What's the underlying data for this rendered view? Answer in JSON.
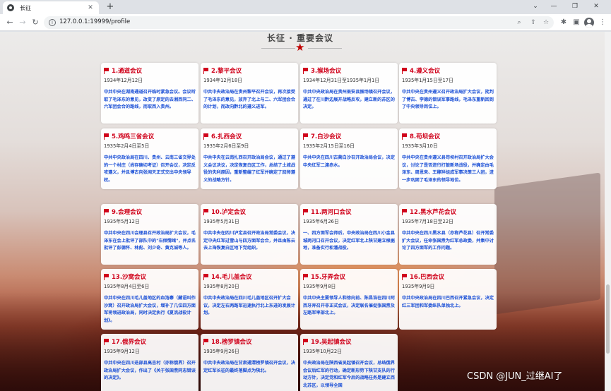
{
  "browser": {
    "tab_title": "长征",
    "url": "127.0.0.1:19999/profile"
  },
  "page": {
    "title": "长征 · 重要会议"
  },
  "meetings": [
    {
      "title": "1.通道会议",
      "date": "1934年12月12日",
      "desc": "中共中央在湖南通道召开临时紧急会议。会议听取了毛泽东的意见，改变了原定的去湘西同二、六军团会合的路线，而取西入贵州。"
    },
    {
      "title": "2.黎平会议",
      "date": "1934年12月18日",
      "desc": "中共中央政治局在贵州黎平召开会议，再次接受了毛泽东的意见，放弃了北上与二、六军团会合的计划，而改向黔北的遵义进军。"
    },
    {
      "title": "3.猴场会议",
      "date": "1934年12月31日至1935年1月1日",
      "desc": "中共中央政治局在贵州瓮安县猴场镇召开会议，通过了在川黔边展开战略反攻，建立新的苏区的决定。"
    },
    {
      "title": "4.遵义会议",
      "date": "1935年1月15日至17日",
      "desc": "中共中央在贵州遵义召开政治局扩大会议，批判了博古、李德的错误军事路线，毛泽东重新回到了中央领导岗位上。"
    },
    {
      "title": "5.鸡鸣三省会议",
      "date": "1935年2月4日至5日",
      "desc": "中共中央政治局在四川、贵州、云南三省交界处的一个村庄（尚存确切考证）召开会议，决定反攻遵义，并且博古向张闻天正式交出中央领导权。"
    },
    {
      "title": "6.扎西会议",
      "date": "1935年2月6日至9日",
      "desc": "中共中央在云南扎西召开政治局会议，通过了遵义会议决议，决定恢复白区工作，总结了土城战役的失利原因，重新整编了红军并确定了回师遵义的战略方针。"
    },
    {
      "title": "7.白沙会议",
      "date": "1935年2月15日至16日",
      "desc": "中共中央在四川古蔺白沙召开政治局会议，决定中央红军二渡赤水。"
    },
    {
      "title": "8.苟坝会议",
      "date": "1935年3月10日",
      "desc": "中共中央在贵州遵义县苟坝村召开政治局扩大会议，讨论了是否进行打鼓新场战役，并确定由毛泽东、周恩来、王稼祥组成军事决策三人团，进一步巩固了毛泽东的领导地位。"
    },
    {
      "title": "9.会理会议",
      "date": "1935年5月12日",
      "desc": "中共中央在四川会理县召开政治局扩大会议，毛泽东在会上批评了部队中的\"右倾情绪\"，并点名批评了彭德怀、林彪、刘少奇、黄克诚等人。"
    },
    {
      "title": "10.泸定会议",
      "date": "1935年5月31日",
      "desc": "中共中央在四川泸定县召开政治局常委会议，决定中央红军过雪山与四方面军会合，并且由陈云去上海恢复白区地下党组织。"
    },
    {
      "title": "11.两河口会议",
      "date": "1935年6月26日",
      "desc": "一、四方面军会师后，中央政治局在四川小金县城两河口召开会议，决定红军北上陕甘建立根据地，准备实行松潘战役。"
    },
    {
      "title": "12.黑水芦花会议",
      "date": "1935年7月18日至22日",
      "desc": "中共中央在四川黑水县（亦称芦花县）召开常委扩大会议，任命张国焘为红军总政委，并集中讨论了四方面军的工作问题。"
    },
    {
      "title": "13.沙窝会议",
      "date": "1935年8月4日至6日",
      "desc": "中共中央在四川毛儿盖地区的血洛寨（藏语叫作沙窝）召开政治局扩大会议，增补了几位四方面军将领进政治局，同时决定执行《夏洮战役计划》。"
    },
    {
      "title": "14.毛儿盖会议",
      "date": "1935年8月20日",
      "desc": "中共中央政治局在四川毛儿盖地区召开扩大会议，决定左右两路军迅速执行北上东进的发展计划。"
    },
    {
      "title": "15.牙弄会议",
      "date": "1935年9月8日",
      "desc": "中共中央主要领导人和徐向前、陈昌浩在四川阿西牙弄召开非正式会议，决定联名催促张国焘及左路军率部北上。"
    },
    {
      "title": "16.巴西会议",
      "date": "1935年9月9日",
      "desc": "中共中央政治局在四川巴西召开紧急会议，决定红三军团和军委纵队单独北上。"
    },
    {
      "title": "17.俄界会议",
      "date": "1935年9月12日",
      "desc": "中共中央在四川迭部县高吉村（亦称俄界）召开政治局扩大会议，作出了《关于张国焘同志错误的决定》。"
    },
    {
      "title": "18.榜罗镇会议",
      "date": "1935年9月26日",
      "desc": "中共中央政治局在甘肃通渭榜罗镇召开会议，决定红军长征的最终落脚点为陕北。"
    },
    {
      "title": "19.吴起镇会议",
      "date": "1935年10月22日",
      "desc": "中央政治局在陕西省吴起镇召开会议，总结俄界会议后红军的行动，确定新形势下陕甘支队的行动方针，决定党和红军今后的战略任务是建立西北苏区，以领导全国"
    }
  ],
  "watermark": "CSDN @JUN_过继AI了"
}
